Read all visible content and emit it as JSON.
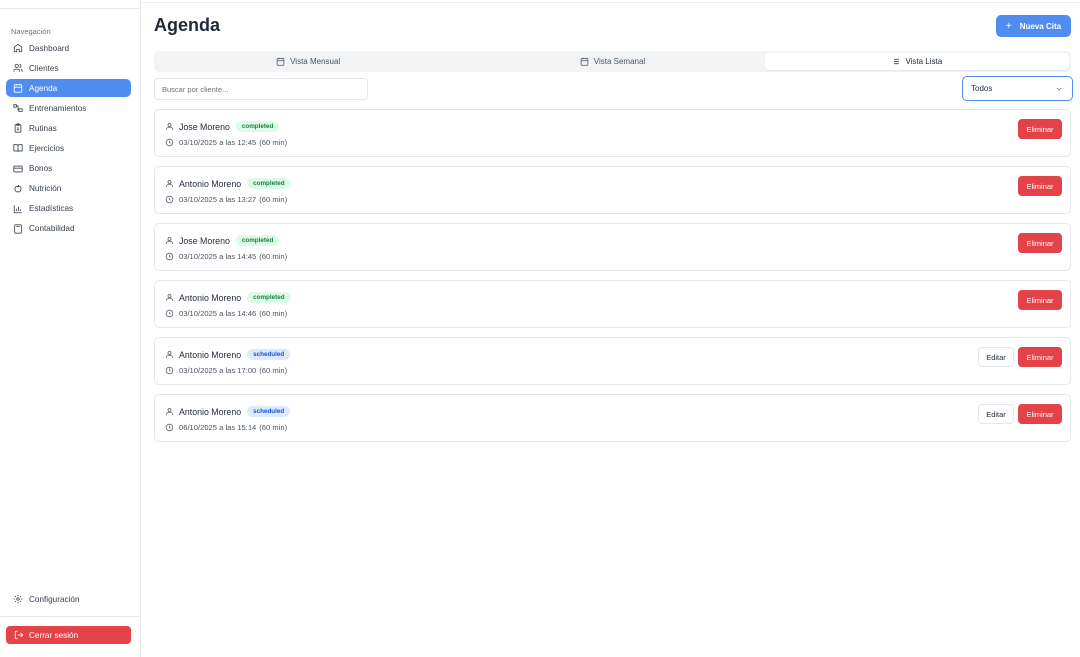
{
  "sidebar": {
    "section_label": "Navegación",
    "items": [
      {
        "label": "Dashboard",
        "icon": "home-icon",
        "active": false
      },
      {
        "label": "Clientes",
        "icon": "users-icon",
        "active": false
      },
      {
        "label": "Agenda",
        "icon": "calendar-icon",
        "active": true
      },
      {
        "label": "Entrenamientos",
        "icon": "dumbbell-icon",
        "active": false
      },
      {
        "label": "Rutinas",
        "icon": "clipboard-icon",
        "active": false
      },
      {
        "label": "Ejercicios",
        "icon": "book-icon",
        "active": false
      },
      {
        "label": "Bonos",
        "icon": "credit-card-icon",
        "active": false
      },
      {
        "label": "Nutrición",
        "icon": "apple-icon",
        "active": false
      },
      {
        "label": "Estadísticas",
        "icon": "bar-chart-icon",
        "active": false
      },
      {
        "label": "Contabilidad",
        "icon": "calculator-icon",
        "active": false
      }
    ],
    "config_label": "Configuración",
    "logout_label": "Cerrar sesión"
  },
  "header": {
    "title": "Agenda",
    "new_button_label": "Nueva Cita"
  },
  "tabs": [
    {
      "label": "Vista Mensual",
      "icon": "calendar-icon",
      "active": false
    },
    {
      "label": "Vista Semanal",
      "icon": "calendar-icon",
      "active": false
    },
    {
      "label": "Vista Lista",
      "icon": "list-icon",
      "active": true
    }
  ],
  "filters": {
    "search_placeholder": "Buscar por cliente...",
    "search_value": "",
    "status_selected": "Todos"
  },
  "appointments": [
    {
      "client": "Jose Moreno",
      "status": "completed",
      "datetime": "03/10/2025 a las 12:45",
      "duration": "(60 min)",
      "editable": false
    },
    {
      "client": "Antonio Moreno",
      "status": "completed",
      "datetime": "03/10/2025 a las 13:27",
      "duration": "(60 min)",
      "editable": false
    },
    {
      "client": "Jose Moreno",
      "status": "completed",
      "datetime": "03/10/2025 a las 14:45",
      "duration": "(60 min)",
      "editable": false
    },
    {
      "client": "Antonio Moreno",
      "status": "completed",
      "datetime": "03/10/2025 a las 14:46",
      "duration": "(60 min)",
      "editable": false
    },
    {
      "client": "Antonio Moreno",
      "status": "scheduled",
      "datetime": "03/10/2025 a las 17:00",
      "duration": "(60 min)",
      "editable": true
    },
    {
      "client": "Antonio Moreno",
      "status": "scheduled",
      "datetime": "06/10/2025 a las 15:14",
      "duration": "(60 min)",
      "editable": true
    }
  ],
  "actions": {
    "edit_label": "Editar",
    "delete_label": "Eliminar"
  },
  "colors": {
    "accent": "#4f8ef0",
    "danger": "#e34348",
    "completed_bg": "#dcfce7",
    "completed_text": "#15803d",
    "scheduled_bg": "#dbeafe",
    "scheduled_text": "#1d4ed8"
  }
}
